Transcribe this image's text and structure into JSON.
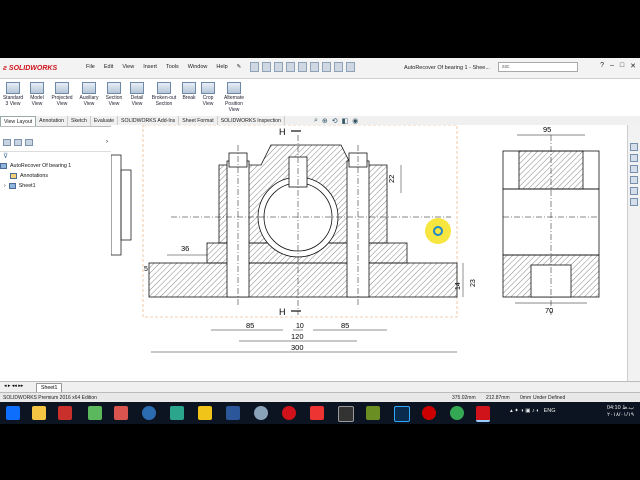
{
  "app": {
    "brand": "SOLIDWORKS",
    "document_title": "AutoRecover Of bearing 1 - Shee...",
    "search_placeholder": "ssc"
  },
  "menu": [
    "File",
    "Edit",
    "View",
    "Insert",
    "Tools",
    "Window",
    "Help"
  ],
  "ribbon_tools": [
    {
      "label": "Standard 3 View",
      "icon": "standard-3-view-icon"
    },
    {
      "label": "Model View",
      "icon": "model-view-icon"
    },
    {
      "label": "Projected View",
      "icon": "projected-view-icon"
    },
    {
      "label": "Auxiliary View",
      "icon": "auxiliary-view-icon"
    },
    {
      "label": "Section View",
      "icon": "section-view-icon"
    },
    {
      "label": "Detail View",
      "icon": "detail-view-icon"
    },
    {
      "label": "Broken-out Section",
      "icon": "broken-out-section-icon"
    },
    {
      "label": "Break",
      "icon": "break-icon"
    },
    {
      "label": "Crop View",
      "icon": "crop-view-icon"
    },
    {
      "label": "Alternate Position View",
      "icon": "alternate-position-view-icon"
    }
  ],
  "tabs": [
    "View Layout",
    "Annotation",
    "Sketch",
    "Evaluate",
    "SOLIDWORKS Add-Ins",
    "Sheet Format",
    "SOLIDWORKS Inspection"
  ],
  "tree": {
    "root": "AutoRecover Of bearing 1",
    "annotations": "Annotations",
    "sheet": "Sheet1"
  },
  "drawing": {
    "section_label_top": "H",
    "section_label_bottom": "H",
    "dims": {
      "d22": "22",
      "d36": "36",
      "d5": "5",
      "d14": "14",
      "d23": "23",
      "d85a": "85",
      "d10": "10",
      "d85b": "85",
      "d120": "120",
      "d300": "300",
      "d95": "95",
      "d70": "70"
    }
  },
  "sheet_tab": "Sheet1",
  "status": {
    "edition": "SOLIDWORKS Premium 2016 x64 Edition",
    "x": "375.02mm",
    "y": "212.87mm",
    "z": "0mm",
    "state": "Under Defined"
  },
  "taskbar": {
    "language": "ENG",
    "time": "04:10 ب.ظ",
    "date": "۲۰۱۸/۰۱/۱۹"
  },
  "colors": {
    "accent_red": "#d0121b",
    "taskbar_bg": "#0b1420"
  }
}
